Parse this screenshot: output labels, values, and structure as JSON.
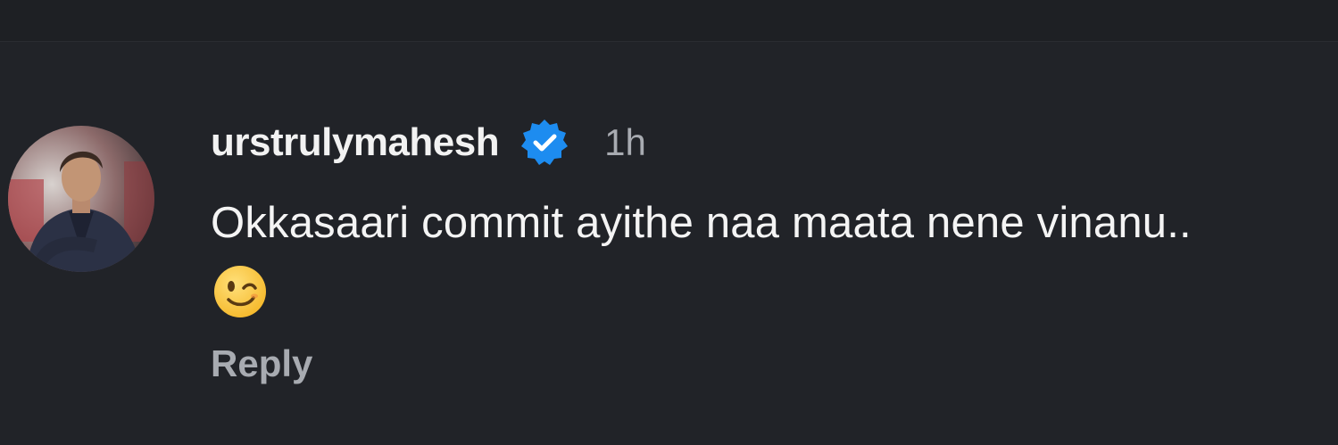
{
  "comment": {
    "username": "urstrulymahesh",
    "timestamp": "1h",
    "text": "Okkasaari commit ayithe naa maata nene vinanu..",
    "emoji": "winking-face",
    "reply_label": "Reply",
    "verified": true
  },
  "colors": {
    "background": "#212328",
    "verified_badge": "#1d8cf0",
    "username": "#f2f2f2",
    "muted_text": "#a8abb1"
  }
}
